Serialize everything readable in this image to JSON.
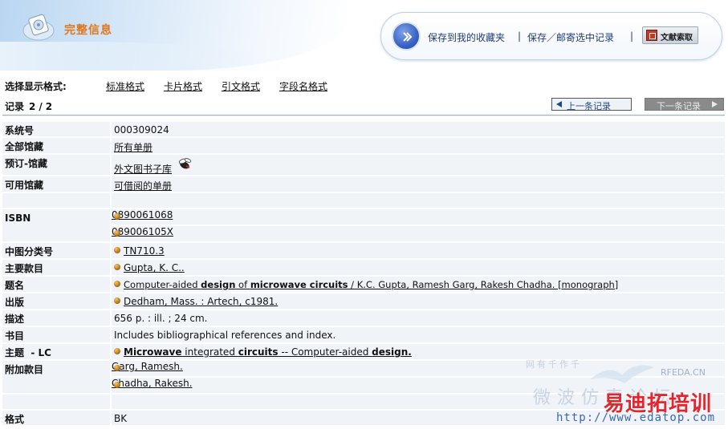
{
  "header": {
    "title": "完整信息",
    "save_favorites": "保存到我的收藏夹",
    "sep": "|",
    "save_mail": "保存／邮寄选中记录",
    "doc_request": "文献索取"
  },
  "format": {
    "label": "选择显示格式:",
    "options": [
      "标准格式",
      "卡片格式",
      "引文格式",
      "字段名格式"
    ]
  },
  "record": {
    "label": "记录",
    "current": "2",
    "slash": "/",
    "total": "2",
    "prev": "上一条记录",
    "next": "下一条记录"
  },
  "fields": {
    "sysno": {
      "label": "系统号",
      "value": "000309024"
    },
    "all_holdings": {
      "label": "全部馆藏",
      "value": "所有单册"
    },
    "reserve": {
      "label": "预订-馆藏",
      "value": "外文图书子库"
    },
    "available": {
      "label": "可用馆藏",
      "value": "可借阅的单册"
    },
    "isbn": {
      "label": "ISBN",
      "values": [
        "0890061068",
        "089006105X"
      ]
    },
    "clc": {
      "label": "中图分类号",
      "value": "TN710.3"
    },
    "main_entry": {
      "label": "主要款目",
      "value": "Gupta, K. C.."
    },
    "title": {
      "label": "题名",
      "p1": "Computer-aided ",
      "p2": "design",
      "p3": " of ",
      "p4": "microwave circuits",
      "p5": " / K.C. Gupta, Ramesh Garg, Rakesh Chadha. [monograph]"
    },
    "publication": {
      "label": "出版",
      "value": "Dedham, Mass. : Artech, c1981."
    },
    "description": {
      "label": "描述",
      "value": "656 p. : ill. ; 24 cm."
    },
    "notes": {
      "label": "书目",
      "value": "Includes bibliographical references and index."
    },
    "subject": {
      "label": "主题  - LC",
      "p1": "Microwave",
      "p2": " integrated ",
      "p3": "circuits",
      "p4": " -- Computer-aided ",
      "p5": "design."
    },
    "added_entry": {
      "label": "附加款目",
      "values": [
        "Garg, Ramesh.",
        "Chadha, Rakesh."
      ]
    },
    "format": {
      "label": "格式",
      "value": "BK"
    }
  },
  "watermark": {
    "rfeda": "RFEDA.CN",
    "brand": "易迪拓培训",
    "url": "http://www.edatop.com",
    "faint_top": "网有千作千",
    "faint_mid": "微波仿真论坛"
  },
  "colors": {
    "title_orange": "#e0761c",
    "link_blue": "#1f3c78",
    "row_bg": "#f0f4f8",
    "brand_red": "#e3262e"
  }
}
